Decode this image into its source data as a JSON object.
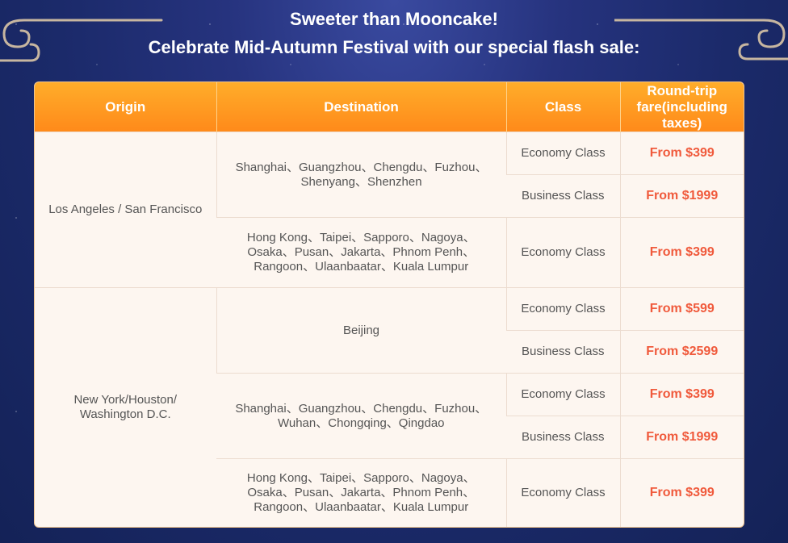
{
  "header": {
    "title": "Sweeter than Mooncake!",
    "subtitle": "Celebrate Mid-Autumn Festival with our special flash sale:"
  },
  "table": {
    "columns": [
      "Origin",
      "Destination",
      "Class",
      "Round-trip fare(including taxes)"
    ],
    "groups": [
      {
        "origin": "Los Angeles / San Francisco",
        "destinations": [
          {
            "name": "Shanghai、Guangzhou、Chengdu、Fuzhou、Shenyang、Shenzhen",
            "fares": [
              {
                "class": "Economy Class",
                "price": "From $399"
              },
              {
                "class": "Business Class",
                "price": "From $1999"
              }
            ]
          },
          {
            "name": "Hong Kong、Taipei、Sapporo、Nagoya、Osaka、Pusan、Jakarta、Phnom Penh、Rangoon、Ulaanbaatar、Kuala Lumpur",
            "fares": [
              {
                "class": "Economy Class",
                "price": "From $399"
              }
            ]
          }
        ]
      },
      {
        "origin": "New York/Houston/ Washington D.C.",
        "destinations": [
          {
            "name": "Beijing",
            "fares": [
              {
                "class": "Economy Class",
                "price": "From $599"
              },
              {
                "class": "Business Class",
                "price": "From $2599"
              }
            ]
          },
          {
            "name": "Shanghai、Guangzhou、Chengdu、Fuzhou、Wuhan、Chongqing、Qingdao",
            "fares": [
              {
                "class": "Economy Class",
                "price": "From $399"
              },
              {
                "class": "Business Class",
                "price": "From $1999"
              }
            ]
          },
          {
            "name": "Hong Kong、Taipei、Sapporo、Nagoya、Osaka、Pusan、Jakarta、Phnom Penh、Rangoon、Ulaanbaatar、Kuala Lumpur",
            "fares": [
              {
                "class": "Economy Class",
                "price": "From $399"
              }
            ]
          }
        ]
      }
    ]
  },
  "colors": {
    "header_orange": "#ff8a1a",
    "price_red": "#f05a3c",
    "background_navy": "#1b2a6a"
  }
}
